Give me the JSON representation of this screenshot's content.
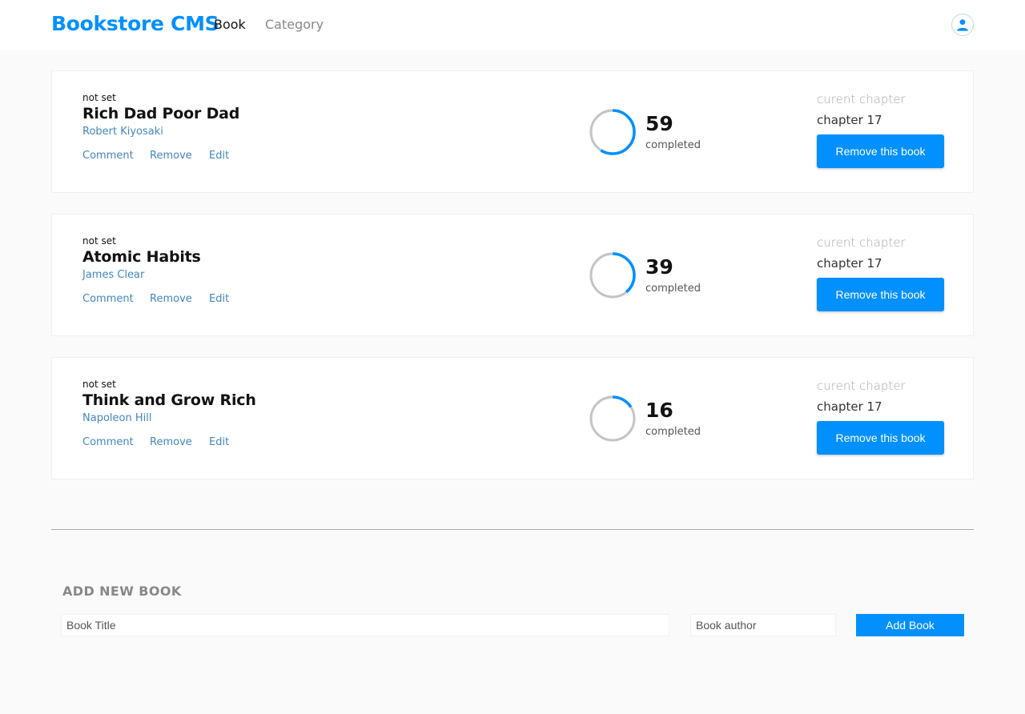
{
  "header": {
    "brand": "Bookstore CMS",
    "nav": {
      "book": "Book",
      "category": "Category"
    },
    "user_icon": "user-icon",
    "accent_color": "#0290ff"
  },
  "books": [
    {
      "category": "not set",
      "title": "Rich Dad Poor Dad",
      "author": "Robert Kiyosaki",
      "comment": "Comment",
      "remove": "Remove",
      "edit": "Edit",
      "percent": "59",
      "progress": 0.59,
      "completed": "completed",
      "chapter_label": "curent chapter",
      "chapter": "chapter 17",
      "remove_button": "Remove this book"
    },
    {
      "category": "not set",
      "title": "Atomic Habits",
      "author": "James Clear",
      "comment": "Comment",
      "remove": "Remove",
      "edit": "Edit",
      "percent": "39",
      "progress": 0.39,
      "completed": "completed",
      "chapter_label": "curent chapter",
      "chapter": "chapter 17",
      "remove_button": "Remove this book"
    },
    {
      "category": "not set",
      "title": "Think and Grow Rich",
      "author": "Napoleon Hill",
      "comment": "Comment",
      "remove": "Remove",
      "edit": "Edit",
      "percent": "16",
      "progress": 0.16,
      "completed": "completed",
      "chapter_label": "curent chapter",
      "chapter": "chapter 17",
      "remove_button": "Remove this book"
    }
  ],
  "add_form": {
    "heading": "ADD NEW BOOK",
    "title_placeholder": "Book Title",
    "author_placeholder": "Book author",
    "submit_label": "Add Book"
  }
}
